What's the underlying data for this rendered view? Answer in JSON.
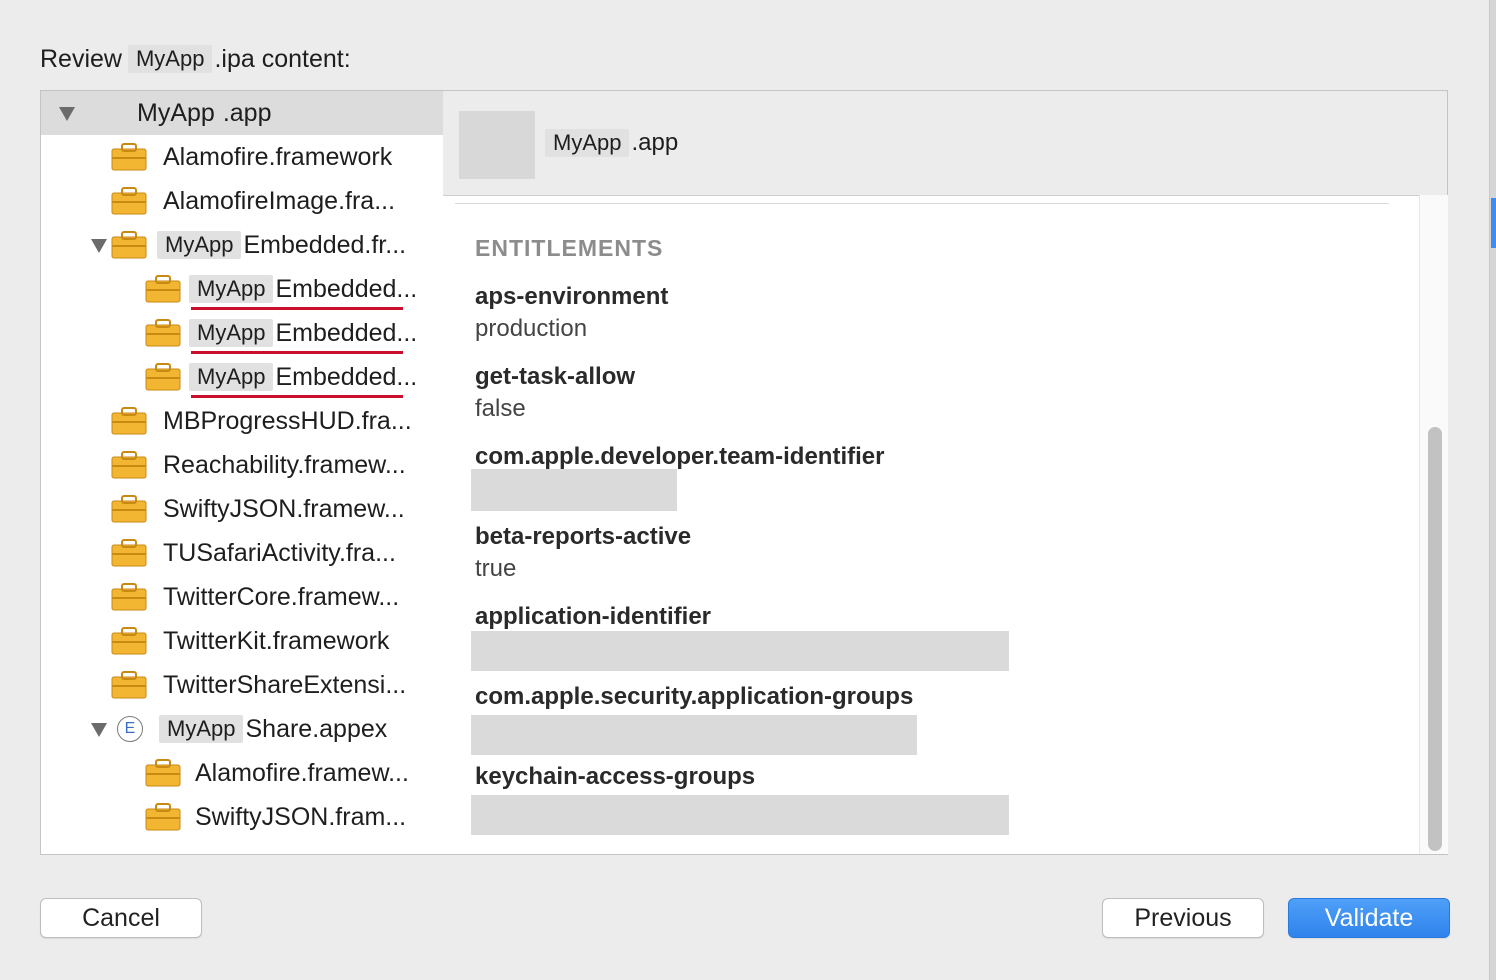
{
  "dialog": {
    "title_prefix": "Review",
    "title_app_name": "MyApp",
    "title_suffix": ".ipa content:"
  },
  "tree": {
    "items": [
      {
        "app_name": "MyApp",
        "name": ".app",
        "icon": "app-icon",
        "expanded": true,
        "selected": true
      },
      {
        "name": "Alamofire.framework",
        "icon": "framework-folder-icon"
      },
      {
        "name": "AlamofireImage.fra...",
        "icon": "framework-folder-icon"
      },
      {
        "app_name": "MyApp",
        "name": "Embedded.fr...",
        "icon": "framework-folder-icon",
        "expanded": true
      },
      {
        "app_name": "MyApp",
        "name": "Embedded...",
        "icon": "framework-folder-icon",
        "underlined": true
      },
      {
        "app_name": "MyApp",
        "name": "Embedded...",
        "icon": "framework-folder-icon",
        "underlined": true
      },
      {
        "app_name": "MyApp",
        "name": "Embedded...",
        "icon": "framework-folder-icon",
        "underlined": true
      },
      {
        "name": "MBProgressHUD.fra...",
        "icon": "framework-folder-icon"
      },
      {
        "name": "Reachability.framew...",
        "icon": "framework-folder-icon"
      },
      {
        "name": "SwiftyJSON.framew...",
        "icon": "framework-folder-icon"
      },
      {
        "name": "TUSafariActivity.fra...",
        "icon": "framework-folder-icon"
      },
      {
        "name": "TwitterCore.framew...",
        "icon": "framework-folder-icon"
      },
      {
        "name": "TwitterKit.framework",
        "icon": "framework-folder-icon"
      },
      {
        "name": "TwitterShareExtensi...",
        "icon": "framework-folder-icon"
      },
      {
        "app_name": "MyApp",
        "name": "Share.appex",
        "icon": "extension-icon",
        "icon_letter": "E",
        "expanded": true
      },
      {
        "name": "Alamofire.framew...",
        "icon": "framework-folder-icon"
      },
      {
        "name": "SwiftyJSON.fram...",
        "icon": "framework-folder-icon"
      }
    ]
  },
  "detail": {
    "header_app_name": "MyApp",
    "header_suffix": ".app",
    "section_title": "ENTITLEMENTS",
    "entitlements": [
      {
        "key": "aps-environment",
        "value": "production"
      },
      {
        "key": "get-task-allow",
        "value": "false"
      },
      {
        "key": "com.apple.developer.team-identifier",
        "value": ""
      },
      {
        "key": "beta-reports-active",
        "value": "true"
      },
      {
        "key": "application-identifier",
        "value": ""
      },
      {
        "key": "com.apple.security.application-groups",
        "value": ""
      },
      {
        "key": "keychain-access-groups",
        "value": ""
      }
    ]
  },
  "buttons": {
    "cancel": "Cancel",
    "previous": "Previous",
    "validate": "Validate"
  },
  "colors": {
    "accent": "#2f82ec",
    "underline": "#c8102e",
    "folder": "#f2b632"
  }
}
